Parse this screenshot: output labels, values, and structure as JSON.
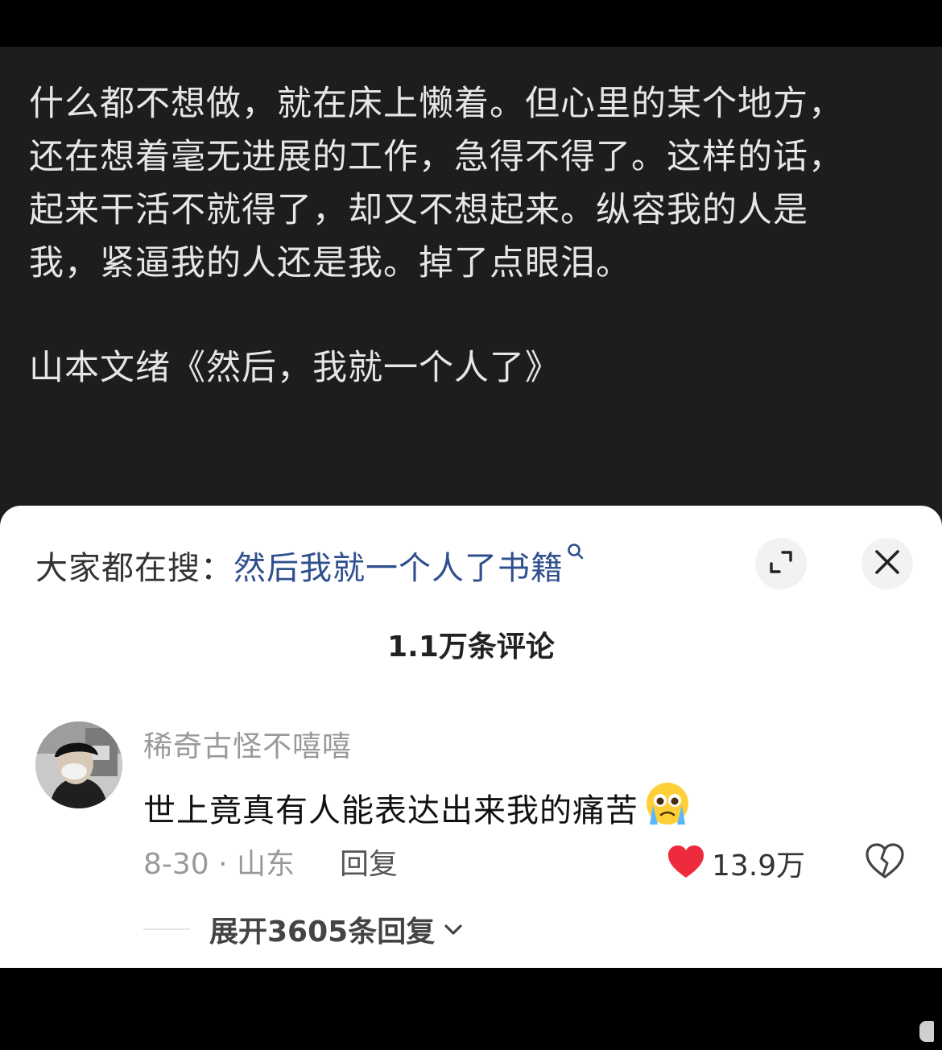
{
  "post": {
    "lines": [
      "什么都不想做，就在床上懒着。但心里的某个地方，",
      "还在想着毫无进展的工作，急得不得了。这样的话，",
      "起来干活不就得了，却又不想起来。纵容我的人是",
      "我，紧逼我的人还是我。掉了点眼泪。"
    ],
    "source": "山本文绪《然后，我就一个人了》"
  },
  "sheet": {
    "search_prefix": "大家都在搜：",
    "search_query": "然后我就一个人了书籍",
    "comment_count": "1.1万条评论"
  },
  "comment": {
    "username": "稀奇古怪不嘻嘻",
    "text": "世上竟真有人能表达出来我的痛苦",
    "date_location": "8-30 · 山东",
    "reply_label": "回复",
    "like_count": "13.9万",
    "expand_replies": "展开3605条回复"
  },
  "colors": {
    "post_bg": "#1d1d1d",
    "link_blue": "#2f4f8f",
    "like_red": "#ee2a3d"
  }
}
